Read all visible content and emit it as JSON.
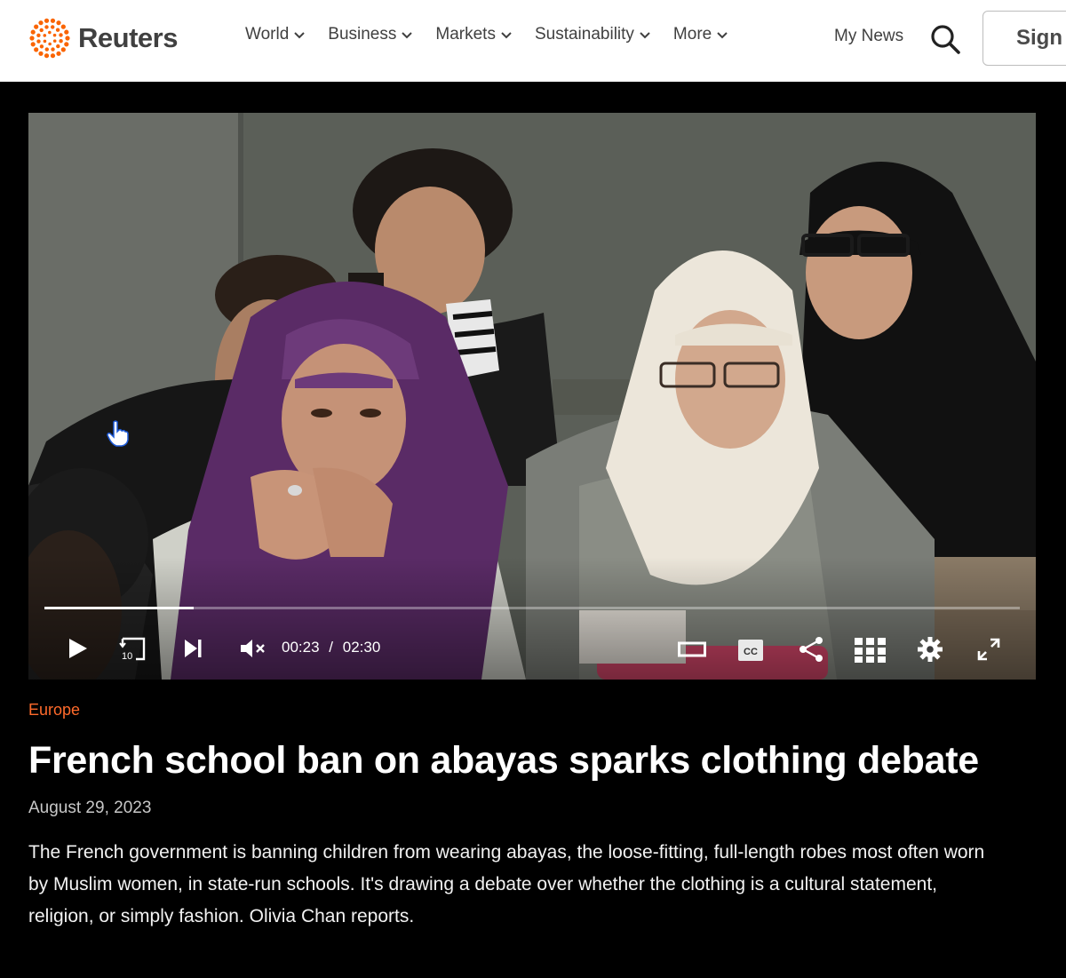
{
  "header": {
    "logo_text": "Reuters",
    "brand_color": "#fa6400",
    "nav": [
      {
        "label": "World"
      },
      {
        "label": "Business"
      },
      {
        "label": "Markets"
      },
      {
        "label": "Sustainability"
      },
      {
        "label": "More"
      }
    ],
    "my_news": "My News",
    "sign_in_label": "Sign"
  },
  "video": {
    "current_time": "00:23",
    "time_separator": "/",
    "duration": "02:30",
    "progress_fraction": 0.153,
    "replay_seconds": "10",
    "cc_label": "CC",
    "icons": [
      "play-icon",
      "replay-10-icon",
      "skip-next-icon",
      "mute-icon",
      "theater-mode-icon",
      "closed-captions-icon",
      "share-icon",
      "grid-icon",
      "settings-icon",
      "fullscreen-icon"
    ]
  },
  "article": {
    "category": "Europe",
    "category_color": "#ff6a2b",
    "title": "French school ban on abayas sparks clothing debate",
    "date": "August 29, 2023",
    "summary": "The French government is banning children from wearing abayas, the loose-fitting, full-length robes most often worn by Muslim women, in state-run schools. It's drawing a debate over whether the clothing is a cultural statement, religion, or simply fashion. Olivia Chan reports."
  }
}
